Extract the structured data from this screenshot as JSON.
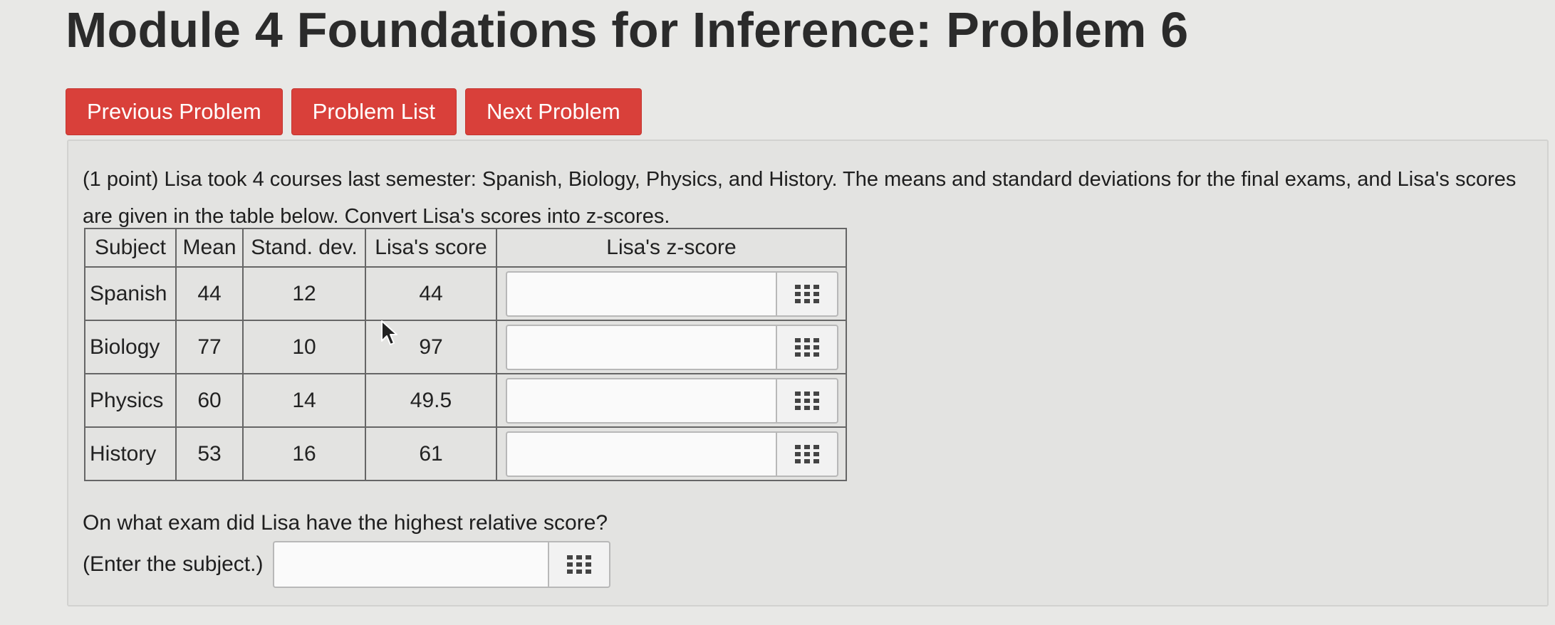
{
  "page": {
    "title": "Module 4 Foundations for Inference: Problem 6"
  },
  "nav": {
    "previous": "Previous Problem",
    "list": "Problem List",
    "next": "Next Problem",
    "button_color": "#d9403a"
  },
  "problem": {
    "prompt": "(1 point) Lisa took 4 courses last semester: Spanish, Biology, Physics, and History. The means and standard deviations for the final exams, and Lisa's scores are given in the table below. Convert Lisa's scores into z-scores.",
    "table": {
      "headers": [
        "Subject",
        "Mean",
        "Stand. dev.",
        "Lisa's score",
        "Lisa's z-score"
      ],
      "rows": [
        {
          "subject": "Spanish",
          "mean": "44",
          "sd": "12",
          "score": "44",
          "z": ""
        },
        {
          "subject": "Biology",
          "mean": "77",
          "sd": "10",
          "score": "97",
          "z": ""
        },
        {
          "subject": "Physics",
          "mean": "60",
          "sd": "14",
          "score": "49.5",
          "z": ""
        },
        {
          "subject": "History",
          "mean": "53",
          "sd": "16",
          "score": "61",
          "z": ""
        }
      ]
    },
    "question": "On what exam did Lisa have the highest relative score?",
    "subject_label": "(Enter the subject.)",
    "subject_value": ""
  },
  "icons": {
    "answer_tool": "grid-icon",
    "pointer": "mouse-pointer-icon"
  }
}
